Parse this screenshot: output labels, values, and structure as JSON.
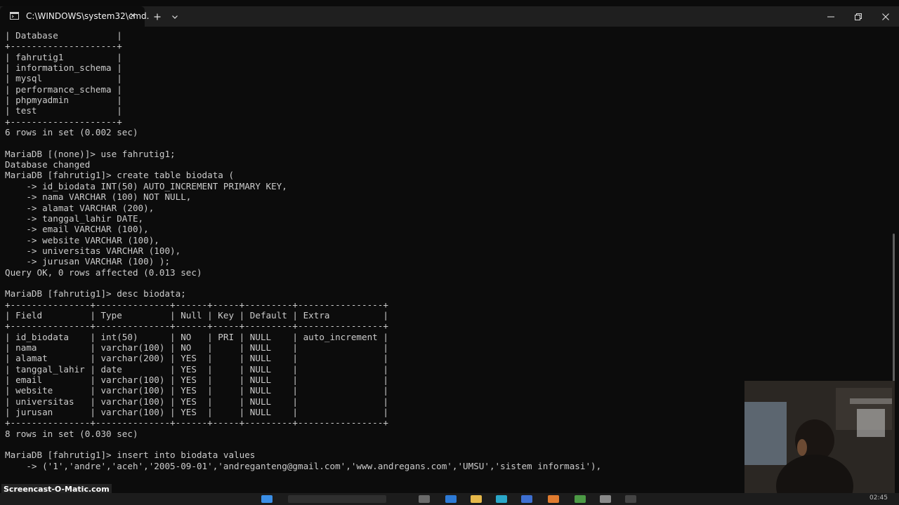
{
  "window": {
    "tab_title": "C:\\WINDOWS\\system32\\cmd.",
    "icons": [
      "terminal-icon",
      "close-icon",
      "plus-icon",
      "chevron-down-icon",
      "minimize-icon",
      "restore-icon",
      "close-icon"
    ]
  },
  "terminal": {
    "lines": [
      "| Database           |",
      "+--------------------+",
      "| fahrutig1          |",
      "| information_schema |",
      "| mysql              |",
      "| performance_schema |",
      "| phpmyadmin         |",
      "| test               |",
      "+--------------------+",
      "6 rows in set (0.002 sec)",
      "",
      "MariaDB [(none)]> use fahrutig1;",
      "Database changed",
      "MariaDB [fahrutig1]> create table biodata (",
      "    -> id_biodata INT(50) AUTO_INCREMENT PRIMARY KEY,",
      "    -> nama VARCHAR (100) NOT NULL,",
      "    -> alamat VARCHAR (200),",
      "    -> tanggal_lahir DATE,",
      "    -> email VARCHAR (100),",
      "    -> website VARCHAR (100),",
      "    -> universitas VARCHAR (100),",
      "    -> jurusan VARCHAR (100) );",
      "Query OK, 0 rows affected (0.013 sec)",
      "",
      "MariaDB [fahrutig1]> desc biodata;",
      "+---------------+--------------+------+-----+---------+----------------+",
      "| Field         | Type         | Null | Key | Default | Extra          |",
      "+---------------+--------------+------+-----+---------+----------------+",
      "| id_biodata    | int(50)      | NO   | PRI | NULL    | auto_increment |",
      "| nama          | varchar(100) | NO   |     | NULL    |                |",
      "| alamat        | varchar(200) | YES  |     | NULL    |                |",
      "| tanggal_lahir | date         | YES  |     | NULL    |                |",
      "| email         | varchar(100) | YES  |     | NULL    |                |",
      "| website       | varchar(100) | YES  |     | NULL    |                |",
      "| universitas   | varchar(100) | YES  |     | NULL    |                |",
      "| jurusan       | varchar(100) | YES  |     | NULL    |                |",
      "+---------------+--------------+------+-----+---------+----------------+",
      "8 rows in set (0.030 sec)",
      "",
      "MariaDB [fahrutig1]> insert into biodata values",
      "    -> ('1','andre','aceh','2005-09-01','andreganteng@gmail.com','www.andregans.com','UMSU','sistem informasi'),"
    ]
  },
  "watermark": "Screencast-O-Matic.com",
  "taskbar": {
    "time": "02:45"
  }
}
